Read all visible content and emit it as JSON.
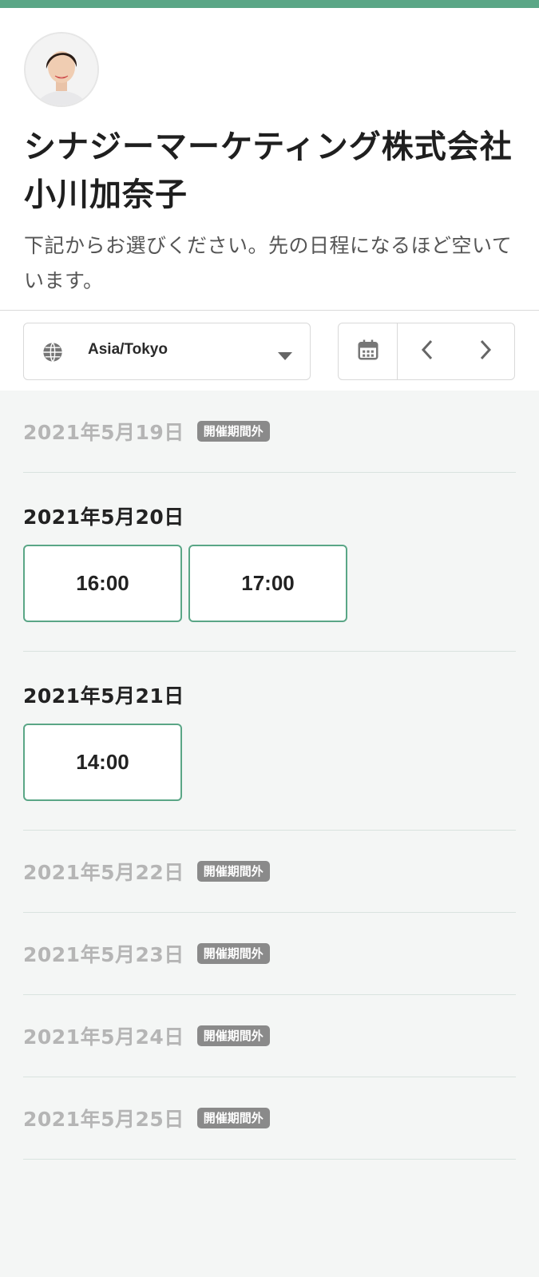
{
  "host": {
    "name": "シナジーマーケティング株式会社　小川加奈子",
    "description": "下記からお選びください。先の日程になるほど空いています。"
  },
  "controls": {
    "timezone": "Asia/Tokyo",
    "globe_icon": "globe-icon",
    "calendar_icon": "calendar-icon",
    "prev_icon": "chevron-left-icon",
    "next_icon": "chevron-right-icon"
  },
  "colors": {
    "accent": "#5aa686",
    "badge": "#8a8a8a",
    "disabled_text": "#b5b5b5"
  },
  "days": [
    {
      "date": "2021年5月19日",
      "badge": "開催期間外"
    },
    {
      "date": "2021年5月20日",
      "slots": [
        "16:00",
        "17:00"
      ]
    },
    {
      "date": "2021年5月21日",
      "slots": [
        "14:00"
      ]
    },
    {
      "date": "2021年5月22日",
      "badge": "開催期間外"
    },
    {
      "date": "2021年5月23日",
      "badge": "開催期間外"
    },
    {
      "date": "2021年5月24日",
      "badge": "開催期間外"
    },
    {
      "date": "2021年5月25日",
      "badge": "開催期間外"
    }
  ]
}
